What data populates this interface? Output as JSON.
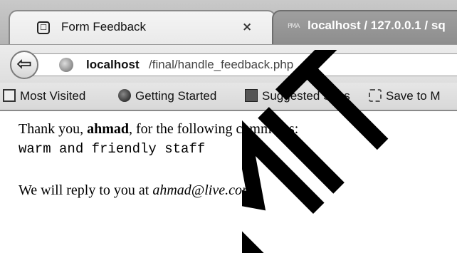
{
  "tabs": {
    "active": {
      "title": "Form Feedback",
      "icon": "page-icon",
      "close_label": "×"
    },
    "inactive": {
      "title": "localhost / 127.0.0.1 / sq",
      "icon": "pma-icon",
      "icon_text": "PMA"
    }
  },
  "nav": {
    "back_icon": "back-arrow-icon",
    "url_host": "localhost",
    "url_path": "/final/handle_feedback.php"
  },
  "bookmarks": [
    {
      "label": "Most Visited",
      "icon": "most-visited-icon"
    },
    {
      "label": "Getting Started",
      "icon": "firefox-icon"
    },
    {
      "label": "Suggested Sites",
      "icon": "suggested-sites-icon"
    },
    {
      "label": "Save to M",
      "icon": "save-icon"
    }
  ],
  "content": {
    "thanks_prefix": "Thank you, ",
    "name": "ahmad",
    "thanks_suffix": ", for the following comments:",
    "comments": "warm and friendly staff",
    "reply_prefix": "We will reply to you at ",
    "email": "ahmad@live.com",
    "reply_suffix": "."
  },
  "watermark": {
    "text": "MIT"
  },
  "colors": {
    "watermark": "#000000",
    "tab_strip": "#b4b4b4"
  }
}
